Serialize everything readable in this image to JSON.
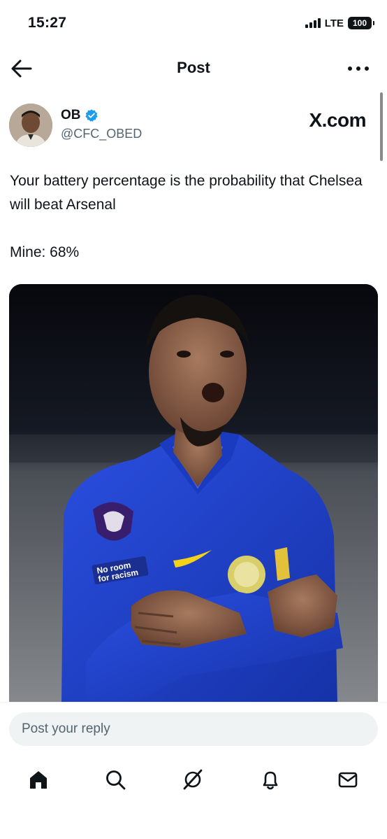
{
  "status_bar": {
    "time": "15:27",
    "network": "LTE",
    "battery": "100"
  },
  "nav": {
    "title": "Post",
    "back_icon": "arrow-left-icon",
    "more_icon": "more-horizontal-icon"
  },
  "post": {
    "author_name": "OB",
    "author_handle": "@CFC_OBED",
    "verified_icon": "verified-badge-icon",
    "source": "X.com",
    "text_line1": "Your battery percentage is the probability that Chelsea will beat Arsenal",
    "text_line2": "Mine: 68%",
    "media_sleeve_text": "No room for racism"
  },
  "reply": {
    "placeholder": "Post your reply"
  },
  "tabs": [
    {
      "icon": "home-icon"
    },
    {
      "icon": "search-icon"
    },
    {
      "icon": "grok-icon"
    },
    {
      "icon": "notifications-bell-icon"
    },
    {
      "icon": "messages-envelope-icon"
    }
  ],
  "colors": {
    "accent_blue": "#1d9bf0",
    "text_primary": "#0f1419",
    "text_secondary": "#536471",
    "kit_blue": "#1d3fc4"
  }
}
